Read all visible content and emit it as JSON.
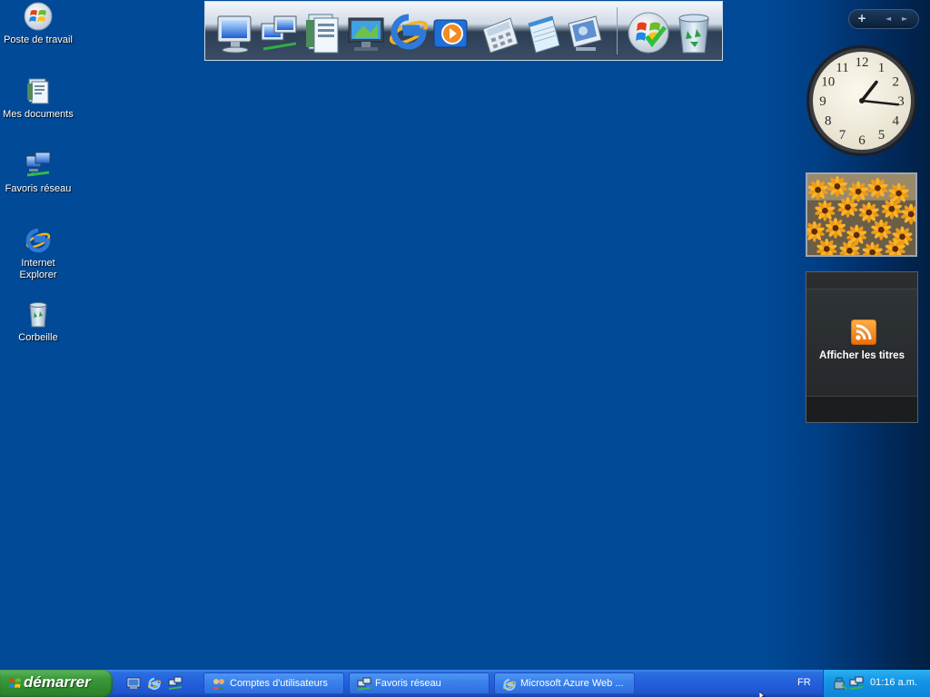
{
  "desktop": {
    "icons": [
      {
        "label": "Poste de travail",
        "icon": "windows-logo-icon"
      },
      {
        "label": "Mes documents",
        "icon": "documents-icon"
      },
      {
        "label": "Favoris réseau",
        "icon": "network-icon"
      },
      {
        "label": "Internet Explorer",
        "icon": "internet-explorer-icon"
      },
      {
        "label": "Corbeille",
        "icon": "recycle-bin-icon"
      }
    ]
  },
  "dock": {
    "items": [
      "computer-icon",
      "network-computers-icon",
      "documents-icon",
      "media-center-icon",
      "internet-explorer-icon",
      "media-player-icon",
      "calculator-icon",
      "notepad-icon",
      "control-panel-icon",
      "windows-orb-icon",
      "recycle-bin-icon"
    ]
  },
  "gadgets": {
    "controls": {
      "add": "+",
      "prev": "◄",
      "next": "►"
    },
    "clock": {
      "time_hour": 1,
      "time_minute": 16
    },
    "feed": {
      "label": "Afficher les titres",
      "icon": "rss-icon"
    }
  },
  "taskbar": {
    "start_label": "démarrer",
    "quick_launch": [
      "show-desktop-icon",
      "internet-explorer-icon",
      "network-icon"
    ],
    "tasks": [
      {
        "label": "Comptes d'utilisateurs",
        "icon": "users-icon"
      },
      {
        "label": "Favoris réseau",
        "icon": "network-icon"
      },
      {
        "label": "Microsoft Azure Web ...",
        "icon": "internet-explorer-icon"
      }
    ],
    "language": "FR",
    "tray": {
      "icons": [
        "safely-remove-icon",
        "network-tray-icon"
      ],
      "time": "01:16 a.m."
    }
  },
  "colors": {
    "desktop": "#004a97",
    "taskbar": "#245edb",
    "start_button": "#3c9a3c",
    "tray": "#0f84d9"
  }
}
